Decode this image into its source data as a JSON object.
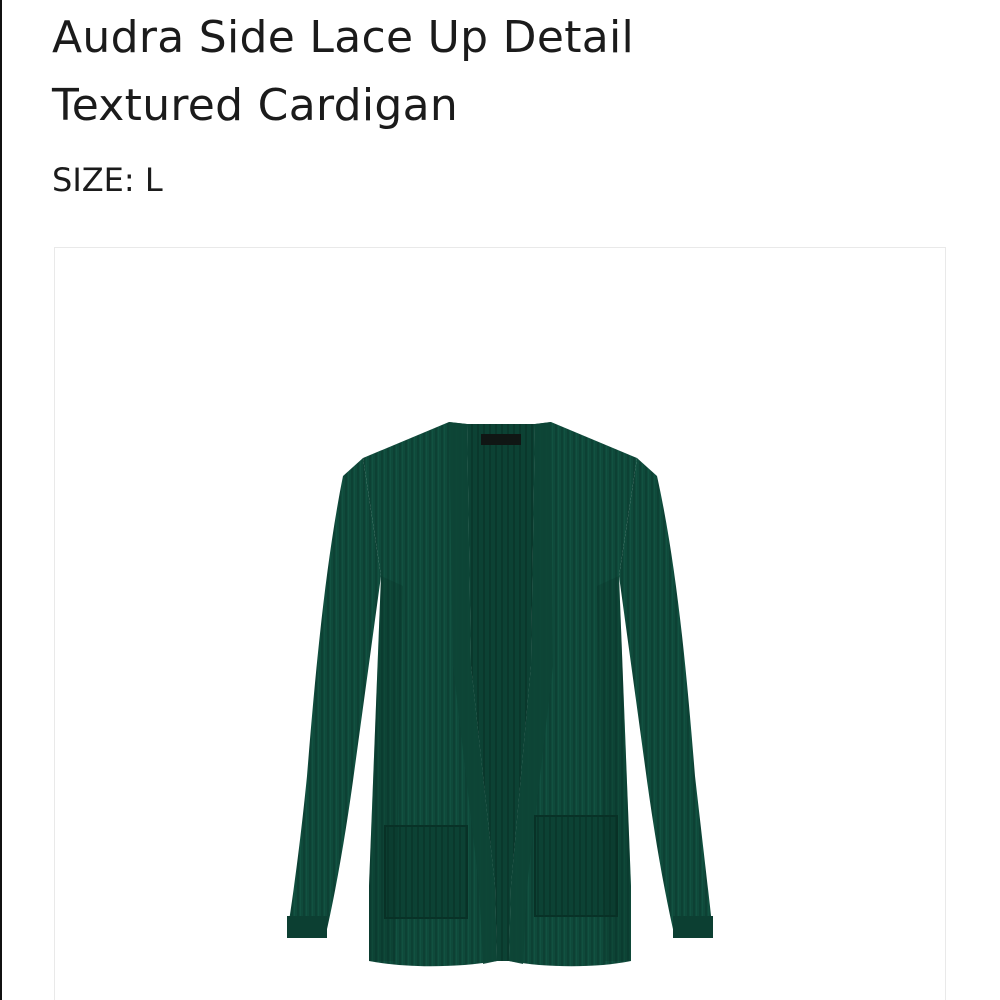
{
  "product": {
    "title_line1": "Audra Side Lace Up Detail",
    "title_line2": "Textured Cardigan",
    "size_label": "SIZE:",
    "size_value": "L",
    "image_icon": "green-knit-cardigan-photo",
    "garment_color": "#0f4a3b",
    "garment_shadow": "#0a3a2e",
    "garment_highlight": "#175c4a"
  }
}
